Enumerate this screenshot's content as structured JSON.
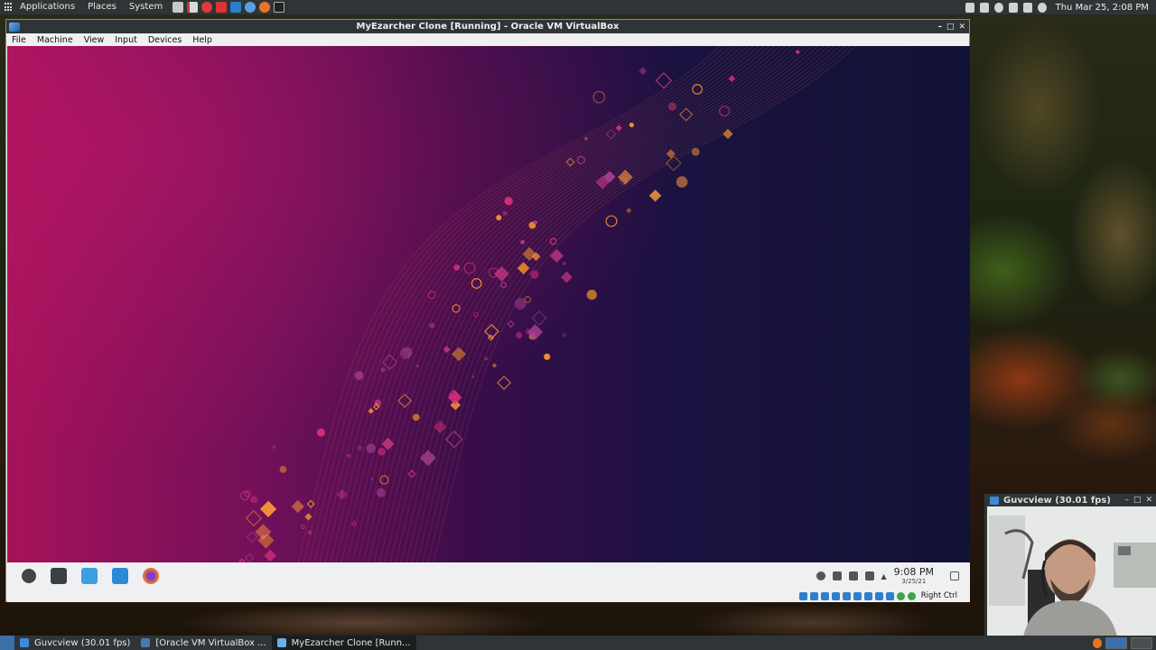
{
  "host_top_panel": {
    "menu": [
      "Applications",
      "Places",
      "System"
    ],
    "clock": "Thu Mar 25,  2:08 PM"
  },
  "vbox": {
    "title": "MyEzarcher Clone [Running] - Oracle VM VirtualBox",
    "menu": [
      "File",
      "Machine",
      "View",
      "Input",
      "Devices",
      "Help"
    ],
    "status_host_key": "Right Ctrl"
  },
  "guest": {
    "clock_time": "9:08 PM",
    "clock_date": "3/25/21",
    "colors": {
      "left": "#a6125a",
      "right": "#111235",
      "accent_orange": "#f0902a",
      "accent_pink": "#e0307a"
    }
  },
  "guvcview": {
    "title": "Guvcview  (30.01 fps)"
  },
  "host_bottom_panel": {
    "tasks": [
      {
        "label": "Guvcview  (30.01 fps)",
        "active": false,
        "icon": "camera-icon"
      },
      {
        "label": "[Oracle VM VirtualBox ...",
        "active": false,
        "icon": "virtualbox-icon"
      },
      {
        "label": "MyEzarcher Clone [Runn...",
        "active": true,
        "icon": "virtualbox-icon"
      }
    ]
  }
}
